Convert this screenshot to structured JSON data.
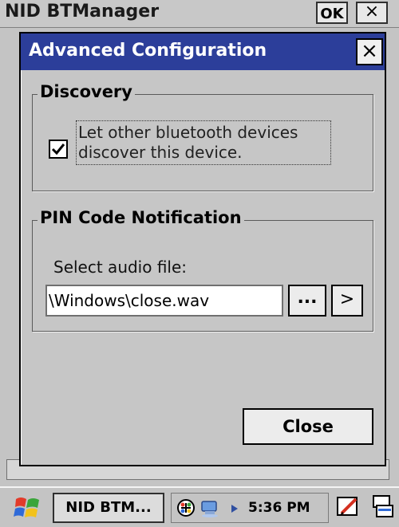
{
  "background_window": {
    "title": "NID BTManager",
    "ok_label": "OK",
    "close_label": "×"
  },
  "dialog": {
    "title": "Advanced Configuration",
    "close_label": "×",
    "discovery": {
      "legend": "Discovery",
      "checkbox_checked": true,
      "checkbox_label": "Let other bluetooth devices discover this device."
    },
    "pin_notification": {
      "legend": "PIN Code Notification",
      "field_label": "Select audio file:",
      "audio_path": "\\Windows\\close.wav",
      "browse_label": "...",
      "play_label": ">"
    },
    "close_button_label": "Close"
  },
  "taskbar": {
    "start_icon": "windows-flag-icon",
    "task_label": "NID BTM...",
    "tray_icons": [
      "bluetooth-icon",
      "network-icon",
      "arrow-icon"
    ],
    "time": "5:36 PM",
    "pen_icon": "pen-input-icon",
    "sip_icon": "input-panel-icon"
  },
  "colors": {
    "title_bar": "#2c3e9a",
    "window_bg": "#c6c6c6"
  }
}
